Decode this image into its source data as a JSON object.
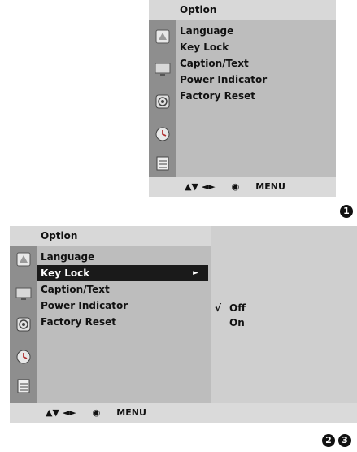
{
  "menu1": {
    "title": "Option",
    "items": [
      "Language",
      "Key Lock",
      "Caption/Text",
      "Power Indicator",
      "Factory Reset"
    ],
    "footer": {
      "nav": "▲▼ ◄►",
      "ok": "◉",
      "menu": "MENU"
    }
  },
  "menu2": {
    "title": "Option",
    "items": [
      "Language",
      "Key Lock",
      "Caption/Text",
      "Power Indicator",
      "Factory Reset"
    ],
    "selected_arrow": "►",
    "submenu": {
      "check": "√",
      "options": [
        "Off",
        "On"
      ]
    },
    "footer": {
      "nav": "▲▼ ◄►",
      "ok": "◉",
      "menu": "MENU"
    }
  },
  "steps": {
    "step1": "1",
    "step2": "2",
    "step3": "3"
  },
  "icons": [
    "picture-icon",
    "tv-icon",
    "audio-icon",
    "time-icon",
    "option-icon"
  ]
}
